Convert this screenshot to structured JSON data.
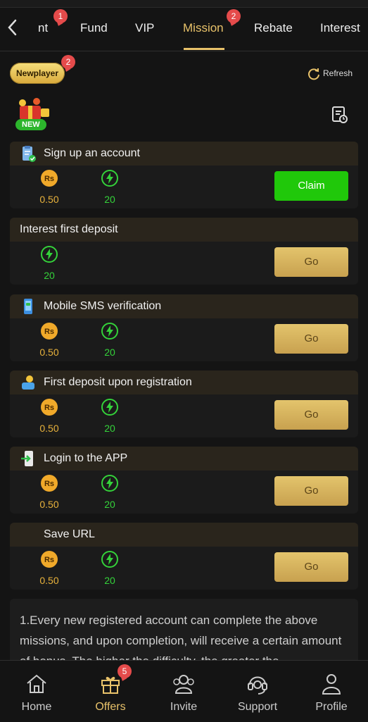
{
  "tabs": {
    "items": [
      {
        "label": "nt",
        "badge": "1"
      },
      {
        "label": "Fund"
      },
      {
        "label": "VIP"
      },
      {
        "label": "Mission",
        "badge": "2",
        "active": true
      },
      {
        "label": "Rebate"
      },
      {
        "label": "Interest"
      }
    ]
  },
  "header": {
    "newplayer_label": "Newplayer",
    "newplayer_badge": "2",
    "refresh_label": "Refresh",
    "new_tag": "NEW"
  },
  "missions": [
    {
      "title": "Sign up an account",
      "icon": "clipboard-check-icon",
      "rs": "0.50",
      "energy": "20",
      "button": "Claim",
      "button_state": "claim"
    },
    {
      "title": "Interest first deposit",
      "icon": "",
      "energy": "20",
      "button": "Go",
      "button_state": "go"
    },
    {
      "title": "Mobile SMS verification",
      "icon": "phone-sms-icon",
      "rs": "0.50",
      "energy": "20",
      "button": "Go",
      "button_state": "go"
    },
    {
      "title": "First deposit upon registration",
      "icon": "person-deposit-icon",
      "rs": "0.50",
      "energy": "20",
      "button": "Go",
      "button_state": "go"
    },
    {
      "title": "Login to the APP",
      "icon": "app-login-icon",
      "rs": "0.50",
      "energy": "20",
      "button": "Go",
      "button_state": "go"
    },
    {
      "title": "Save URL",
      "icon": "",
      "rs": "0.50",
      "energy": "20",
      "button": "Go",
      "button_state": "go"
    }
  ],
  "reward_icon_text": "Rs",
  "description": "1.Every new registered account can complete the above missions, and upon completion, will receive a certain amount of bonus. The higher the difficulty, the greater the",
  "bottom_nav": {
    "items": [
      {
        "label": "Home",
        "icon": "home-icon"
      },
      {
        "label": "Offers",
        "icon": "gift-icon",
        "badge": "5",
        "active": true
      },
      {
        "label": "Invite",
        "icon": "invite-icon"
      },
      {
        "label": "Support",
        "icon": "support-icon"
      },
      {
        "label": "Profile",
        "icon": "profile-icon"
      }
    ]
  },
  "colors": {
    "accent": "#e8c26a",
    "claim": "#20c80a",
    "coin": "#e8b23c",
    "energy": "#34d23a",
    "badge": "#e54b4b"
  }
}
